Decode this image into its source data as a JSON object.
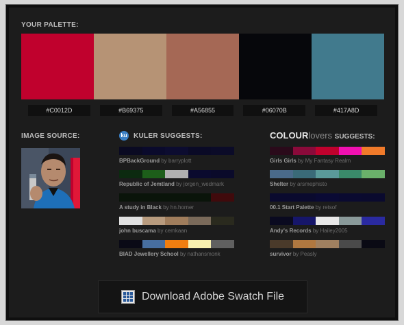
{
  "palette": {
    "heading": "YOUR PALETTE:",
    "colors": [
      "#C0012D",
      "#B69375",
      "#A56855",
      "#06070B",
      "#417A8D"
    ]
  },
  "image_source": {
    "heading": "IMAGE SOURCE:"
  },
  "kuler": {
    "heading": "KULER SUGGESTS:",
    "icon": "kuler-icon",
    "items": [
      {
        "name": "BPBackGround",
        "by": "by",
        "author": "barryplott",
        "colors": [
          "#0a0a22",
          "#0a0a2c",
          "#0c0c30",
          "#0a0a26",
          "#0b0b28"
        ]
      },
      {
        "name": "Republic of Jemtland",
        "by": "by",
        "author": "jorgen_wedmark",
        "colors": [
          "#0c2a10",
          "#1d5e1a",
          "#b0b0b0",
          "#0a0a2e",
          "#0a0a2a"
        ]
      },
      {
        "name": "A study in Black",
        "by": "by",
        "author": "hn.horner",
        "colors": [
          "#0a140a",
          "#0a140a",
          "#0a140a",
          "#0a140a",
          "#400a0c"
        ]
      },
      {
        "name": "john buscama",
        "by": "by",
        "author": "cemkaan",
        "colors": [
          "#e0e0e0",
          "#b89b7e",
          "#a07d5c",
          "#7a6a5a",
          "#2a2a1e"
        ]
      },
      {
        "name": "BIAD Jewellery School",
        "by": "by",
        "author": "nathansmonk",
        "colors": [
          "#0a0a16",
          "#476ea0",
          "#f07e10",
          "#f8f0b0",
          "#606060"
        ]
      }
    ]
  },
  "colourlovers": {
    "heading_brand_bold": "COLOUR",
    "heading_brand_light": "lovers",
    "heading_suffix": "SUGGESTS:",
    "items": [
      {
        "name": "Girls Girls",
        "by": "by",
        "author": "My Fantasy Realm",
        "colors": [
          "#2a0a1a",
          "#8a0a3a",
          "#c0012d",
          "#f010b0",
          "#f07a2a"
        ]
      },
      {
        "name": "Shelter",
        "by": "by",
        "author": "arsmephisto",
        "colors": [
          "#4a6a8a",
          "#3a6a78",
          "#5a9a9a",
          "#3a8a6a",
          "#6ab06a"
        ]
      },
      {
        "name": "00.1 Start Palette",
        "by": "by",
        "author": "retsof",
        "colors": [
          "#0a0a2e",
          "#0a0a2e",
          "#0a0a34",
          "#0a0a30",
          "#0a0a2e"
        ]
      },
      {
        "name": "Andy's Records",
        "by": "by",
        "author": "Hailey2005",
        "colors": [
          "#0a0a20",
          "#16166a",
          "#e8e8e8",
          "#8a9a9a",
          "#2a2aa0"
        ]
      },
      {
        "name": "survivor",
        "by": "by",
        "author": "Peasly",
        "colors": [
          "#4a3a2a",
          "#b07840",
          "#a08060",
          "#4a4a4a",
          "#0a0a14"
        ]
      }
    ]
  },
  "download": {
    "label": "Download Adobe Swatch File",
    "icon": "swatch-file-icon"
  }
}
